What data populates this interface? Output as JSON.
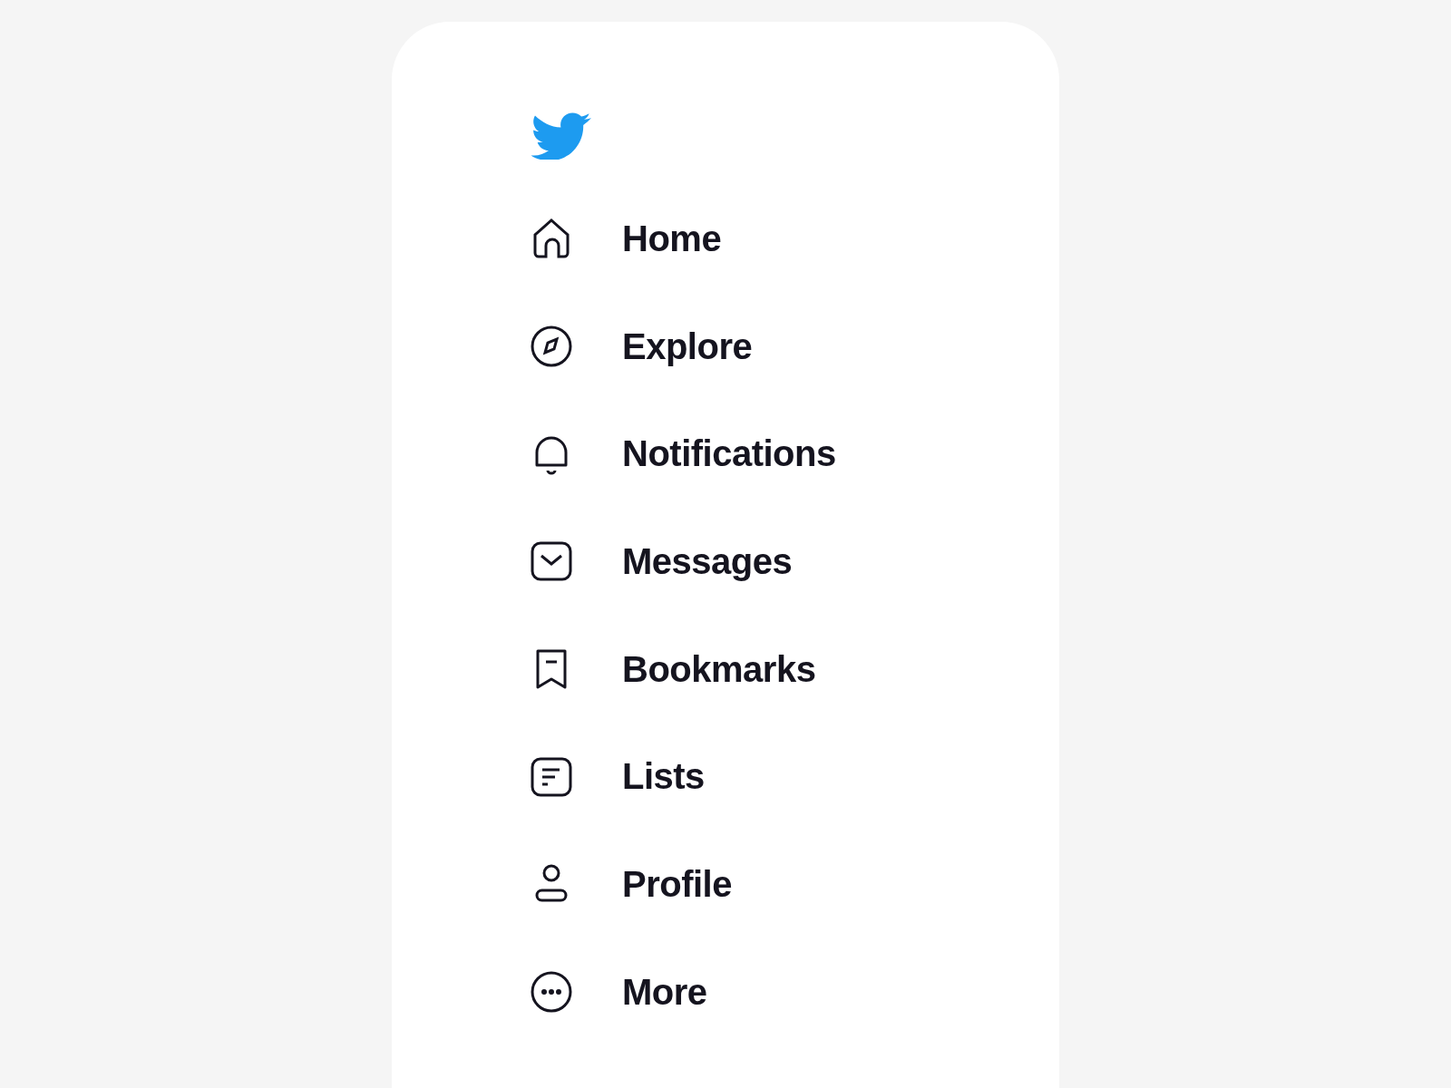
{
  "sidebar": {
    "items": [
      {
        "label": "Home"
      },
      {
        "label": "Explore"
      },
      {
        "label": "Notifications"
      },
      {
        "label": "Messages"
      },
      {
        "label": "Bookmarks"
      },
      {
        "label": "Lists"
      },
      {
        "label": "Profile"
      },
      {
        "label": "More"
      }
    ]
  }
}
